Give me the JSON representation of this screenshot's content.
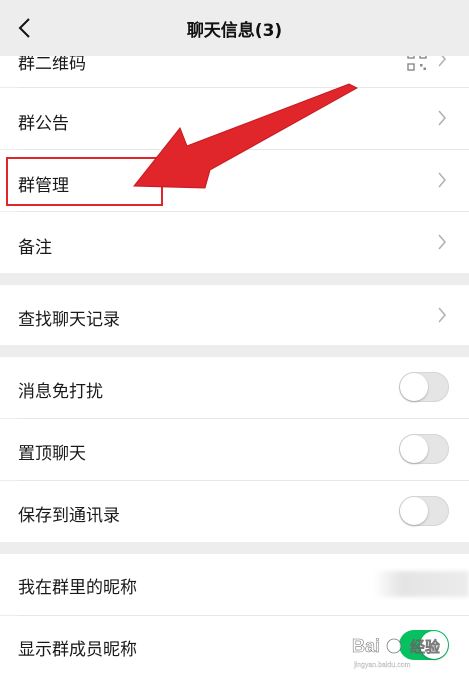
{
  "header": {
    "title": "聊天信息(3)",
    "back_icon": "chevron-left-icon"
  },
  "rows": {
    "qrcode": {
      "label": "群二维码",
      "icon": "qr-code-icon"
    },
    "announcement": {
      "label": "群公告"
    },
    "manage": {
      "label": "群管理"
    },
    "remark": {
      "label": "备注"
    },
    "search_history": {
      "label": "查找聊天记录"
    },
    "mute": {
      "label": "消息免打扰",
      "enabled": false
    },
    "pin": {
      "label": "置顶聊天",
      "enabled": false
    },
    "save_contacts": {
      "label": "保存到通讯录",
      "enabled": false
    },
    "my_nickname": {
      "label": "我在群里的昵称"
    },
    "show_nicknames": {
      "label": "显示群成员昵称",
      "enabled": true
    }
  },
  "annotation": {
    "highlight_color": "#e0252b",
    "arrow_color": "#e0252b"
  },
  "watermark": {
    "text": "Baidu 经验",
    "subtext": "jingyan.baidu.com"
  },
  "colors": {
    "background": "#ededed",
    "row_background": "#ffffff",
    "toggle_on": "#07c160",
    "toggle_off": "#e5e5e5"
  }
}
